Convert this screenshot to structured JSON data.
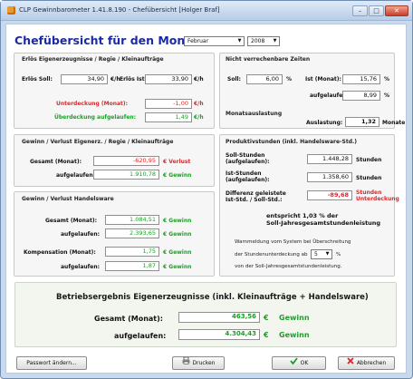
{
  "window": {
    "title": "CLP Gewinnbarometer 1.41.8.190 - Chefübersicht  [Holger Braf]"
  },
  "header": {
    "title": "Chefübersicht für den Monat:",
    "month": "Februar",
    "year": "2008"
  },
  "erloes": {
    "title": "Erlös Eigenerzeugnisse / Regie / Kleinaufträge",
    "soll_label": "Erlös Soll:",
    "soll_value": "34,90",
    "soll_unit": "€/h",
    "ist_label": "Erlös Ist:",
    "ist_value": "33,90",
    "ist_unit": "€/h",
    "unter_label": "Unterdeckung (Monat):",
    "unter_value": "-1,00",
    "unter_unit": "€/h",
    "ueber_label": "Überdeckung aufgelaufen:",
    "ueber_value": "1,49",
    "ueber_unit": "€/h"
  },
  "nvz": {
    "title": "Nicht verrechenbare Zeiten",
    "soll_label": "Soll:",
    "soll_value": "6,00",
    "pct": "%",
    "ist_label": "Ist (Monat):",
    "ist_value": "15,76",
    "aufg_label": "aufgelaufen:",
    "aufg_value": "8,99"
  },
  "auslastung": {
    "title": "Monatsauslastung",
    "label": "Auslastung:",
    "value": "1,32",
    "unit": "Monate"
  },
  "gv_eigen": {
    "title": "Gewinn / Verlust Eigenerz. / Regie / Kleinaufträge",
    "gesamt_label": "Gesamt (Monat):",
    "gesamt_value": "-620,95",
    "gesamt_unit": "€  Verlust",
    "aufg_label": "aufgelaufen:",
    "aufg_value": "1.910,78",
    "aufg_unit": "€  Gewinn"
  },
  "prod": {
    "title": "Produktivstunden (inkl. Handelsware-Std.)",
    "soll_label1": "Soll-Stunden",
    "soll_label2": "(aufgelaufen):",
    "soll_value": "1.448,28",
    "soll_unit": "Stunden",
    "ist_label1": "Ist-Stunden",
    "ist_label2": "(aufgelaufen):",
    "ist_value": "1.358,60",
    "ist_unit": "Stunden",
    "diff_label1": "Differenz geleistete",
    "diff_label2": "Ist-Std. / Soll-Std.:",
    "diff_value": "-89,68",
    "diff_unit1": "Stunden",
    "diff_unit2": "Unterdeckung",
    "note1": "entspricht  1,03 % der",
    "note2": "Soll-Jahresgesamtstundenleistung",
    "warn1": "Warnmeldung vom System bei Überschreitung",
    "warn2": "der Stundenunterdeckung ab",
    "warn_value": "5",
    "warn_pct": "%",
    "warn3": "von der Soll-Jahresgesamtstundenleistung."
  },
  "gv_handel": {
    "title": "Gewinn / Verlust Handelsware",
    "gesamt_label": "Gesamt (Monat):",
    "gesamt_value": "1.084,51",
    "gesamt_unit": "€  Gewinn",
    "aufg_label": "aufgelaufen:",
    "aufg_value": "2.393,65",
    "aufg_unit": "€  Gewinn",
    "komp_label": "Kompensation (Monat):",
    "komp_value": "1,75",
    "komp_unit": "€  Gewinn",
    "komp_aufg_label": "aufgelaufen:",
    "komp_aufg_value": "1,87",
    "komp_aufg_unit": "€  Gewinn"
  },
  "result": {
    "title": "Betriebsergebnis Eigenerzeugnisse (inkl. Kleinaufträge + Handelsware)",
    "gesamt_label": "Gesamt (Monat):",
    "gesamt_value": "463,56",
    "gesamt_unit": "€",
    "gesamt_status": "Gewinn",
    "aufg_label": "aufgelaufen:",
    "aufg_value": "4.304,43",
    "aufg_unit": "€",
    "aufg_status": "Gewinn"
  },
  "buttons": {
    "password": "Passwort ändern...",
    "print": "Drucken",
    "ok": "OK",
    "cancel": "Abbrechen"
  }
}
